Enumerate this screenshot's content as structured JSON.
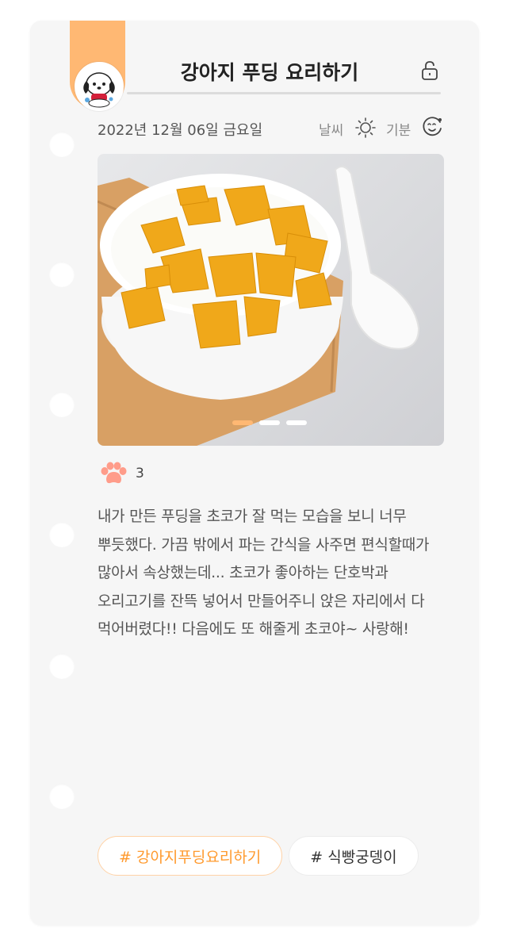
{
  "diary": {
    "title": "강아지 푸딩 요리하기",
    "date": "2022년 12월 06일 금요일",
    "weather_label": "날씨",
    "weather_icon": "sun-icon",
    "mood_label": "기분",
    "mood_icon": "happy-face-icon",
    "lock_icon": "unlock-icon",
    "carousel": {
      "total": 3,
      "active_index": 0
    },
    "likes": "3",
    "body": "내가 만든 푸딩을 초코가 잘 먹는 모습을 보니 너무 뿌듯했다. 가끔 밖에서 파는 간식을 사주면 편식할때가 많아서 속상했는데... 초코가 좋아하는 단호박과 오리고기를 잔뜩 넣어서 만들어주니 앉은 자리에서 다 먹어버렸다!! 다음에도 또 해줄게 초코야~ 사랑해!",
    "tags": [
      {
        "label": "# 강아지푸딩요리하기"
      },
      {
        "label": "# 식빵궁뎅이"
      }
    ]
  },
  "colors": {
    "accent": "#ffb873",
    "tag_accent": "#ff9a2e",
    "paw": "#ff9c8a"
  }
}
